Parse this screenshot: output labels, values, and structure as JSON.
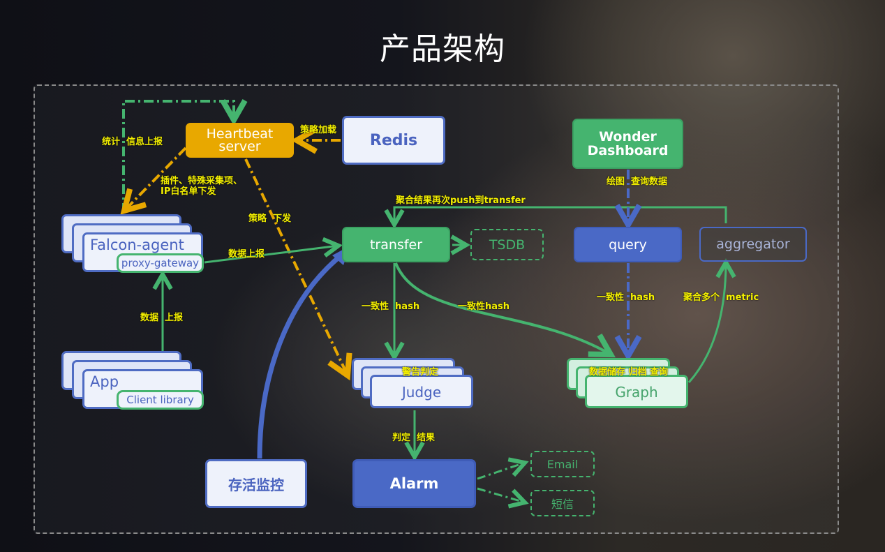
{
  "title": "产品架构",
  "nodes": {
    "heartbeat": "Heartbeat\nserver",
    "heartbeat_line1": "Heartbeat",
    "heartbeat_line2": "server",
    "redis": "Redis",
    "wonder_line1": "Wonder",
    "wonder_line2": "Dashboard",
    "falcon_agent": "Falcon-agent",
    "proxy_gateway": "proxy-gateway",
    "app": "App",
    "client_library": "Client library",
    "transfer": "transfer",
    "tsdb": "TSDB",
    "query": "query",
    "aggregator": "aggregator",
    "judge": "Judge",
    "judge_tag": "警告判定",
    "graph": "Graph",
    "graph_tag": "数据储存 归档 查询",
    "alive_monitor": "存活监控",
    "alarm": "Alarm",
    "email": "Email",
    "sms": "短信"
  },
  "edge_labels": {
    "stats_report": "统计  信息上报",
    "policy_load": "策略加载",
    "plugin_dispatch_1": "插件、特殊采集项、",
    "plugin_dispatch_2": "IP白名单下发",
    "policy_dispatch": "策略  下发",
    "data_report_agent": "数据上报",
    "data_report_app": "数据  上报",
    "aggregate_push": "聚合结果再次push到transfer",
    "draw_query": "绘图  查询数据",
    "hash_judge": "一致性  hash",
    "hash_graph": "一致性hash",
    "hash_query": "一致性  hash",
    "aggregate_metric": "聚合多个  metric",
    "judge_result": "判定  结果"
  },
  "colors": {
    "green": "#45b46f",
    "blue": "#4a69c6",
    "yellow": "#e8a800",
    "label_yellow": "#f4f000"
  }
}
